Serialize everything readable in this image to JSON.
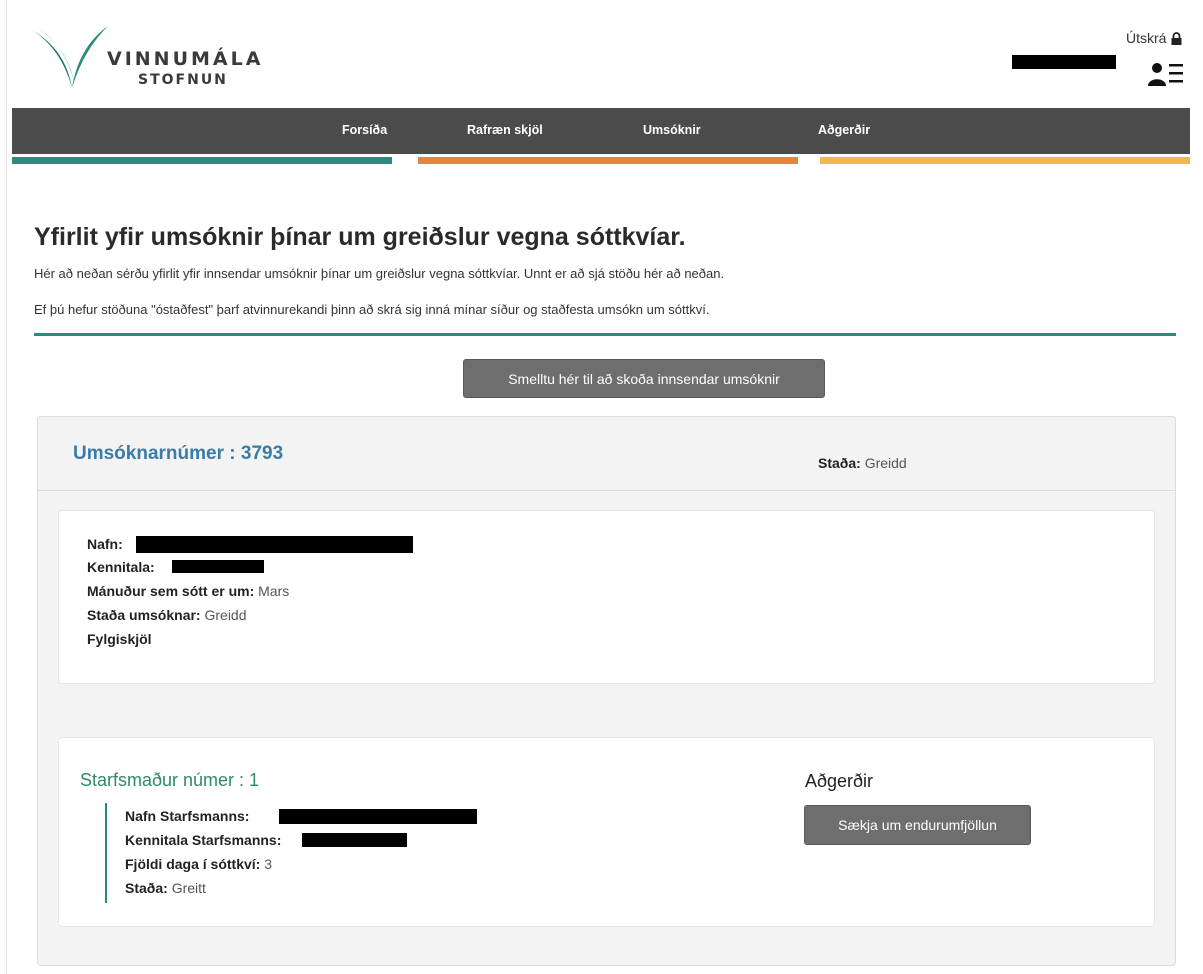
{
  "header": {
    "logo_line1": "VINNUMÁLA",
    "logo_line2": "STOFNUN",
    "logout_label": "Útskrá"
  },
  "nav": {
    "items": [
      "Forsíða",
      "Rafræn skjöl",
      "Umsóknir",
      "Aðgerðir"
    ]
  },
  "colors": {
    "nav_bg": "#4b4b4b",
    "accent_teal": "#2b8a80",
    "accent_orange": "#e8833a",
    "accent_yellow": "#f0b94a",
    "button_gray": "#6e6e6e",
    "link_blue": "#3b7ca6"
  },
  "page": {
    "title": "Yfirlit yfir umsóknir þínar um greiðslur vegna sóttkvíar.",
    "intro1": "Hér að neðan sérðu yfirlit yfir innsendar umsóknir þínar um greiðslur vegna sóttkvíar. Unnt er að sjá stöðu hér að neðan.",
    "intro2": "Ef þú hefur stöðuna \"óstaðfest\" þarf atvinnurekandi þinn að skrá sig inná mínar síður og staðfesta umsókn um sóttkví.",
    "view_button": "Smelltu hér til að skoða innsendar umsóknir"
  },
  "application": {
    "number_label": "Umsóknarnúmer : 3793",
    "status_label": "Staða:",
    "status_value": "Greidd",
    "fields": {
      "name_label": "Nafn:",
      "kennitala_label": "Kennitala:",
      "month_label": "Mánuður sem sótt er um:",
      "month_value": "Mars",
      "app_status_label": "Staða umsóknar:",
      "app_status_value": "Greidd",
      "attachments_label": "Fylgiskjöl"
    }
  },
  "employee": {
    "title": "Starfsmaður númer : 1",
    "name_label": "Nafn Starfsmanns:",
    "kennitala_label": "Kennitala Starfsmanns:",
    "days_label": "Fjöldi daga í sóttkví:",
    "days_value": "3",
    "status_label": "Staða:",
    "status_value": "Greitt",
    "actions_title": "Aðgerðir",
    "reprocess_button": "Sækja um endurumfjöllun"
  },
  "icons": {
    "lock": "lock-icon",
    "user_menu": "user-menu-icon",
    "logo": "logo-icon"
  }
}
